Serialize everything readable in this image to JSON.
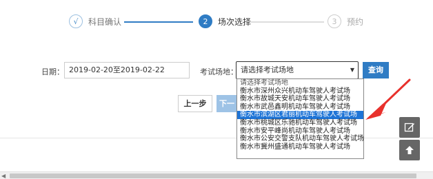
{
  "steps": [
    {
      "icon": "√",
      "label": "科目确认",
      "state": "done"
    },
    {
      "icon": "2",
      "label": "场次选择",
      "state": "active"
    },
    {
      "icon": "3",
      "label": "预约",
      "state": "todo"
    }
  ],
  "form": {
    "date_label": "日期：",
    "date_value": "2019-02-20至2019-02-22",
    "venue_label": "考试场地：",
    "venue_select_value": "请选择考试场地",
    "query_button": "查询"
  },
  "nav": {
    "prev_button": "上一步",
    "next_button": "下一"
  },
  "dropdown": {
    "options": [
      "请选择考试场地",
      "衡水市深州众兴机动车驾驶人考试场",
      "衡水市故城天安机动车驾驶人考试场",
      "衡水市武邑鑫明机动车驾驶人考试场",
      "衡水市滨湖区君丽机动车驾驶人考试场",
      "衡水市桃城区乐驰机动车驾驶人考试场",
      "衡水市安平峰尚机动车驾驶人考试场",
      "衡水市公安交警支队机动车驾驶人考试场",
      "衡水市冀州盛通机动车驾驶人考试场"
    ],
    "selected_index": 4
  },
  "side": {
    "edit_icon": "edit-icon",
    "top_icon": "arrow-up-icon"
  },
  "colors": {
    "primary": "#2f7cc4",
    "selected_option": "#1e74d6",
    "annotation_arrow": "#e8312c"
  }
}
